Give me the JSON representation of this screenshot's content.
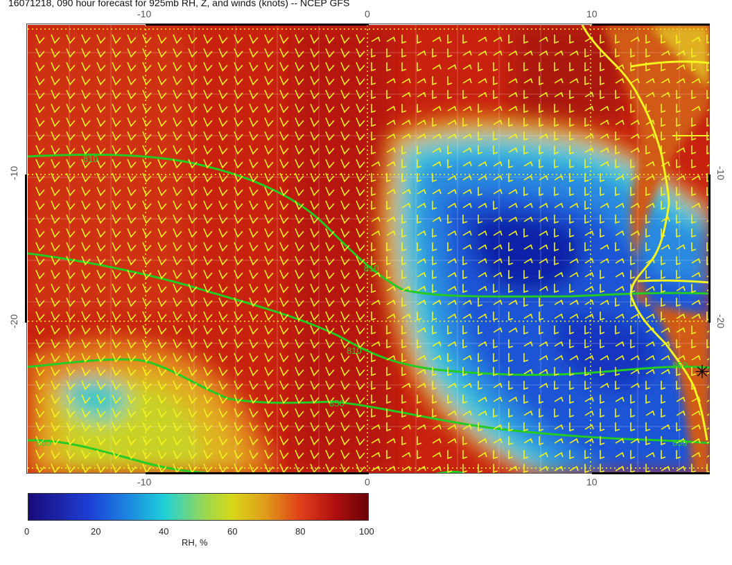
{
  "title": "16071218, 090 hour forecast for 925mb RH, Z, and winds (knots) -- NCEP GFS",
  "axes": {
    "top": [
      "-10",
      "0",
      "10"
    ],
    "bottom": [
      "-10",
      "0",
      "10"
    ],
    "left": [
      "-10",
      "-20"
    ],
    "right": [
      "-10",
      "-20"
    ]
  },
  "contours": {
    "c1": "810",
    "c2": "810",
    "c3": "810",
    "c4": "850",
    "c5": "850",
    "c6": "850",
    "c7": "850"
  },
  "colorbar": {
    "ticks": [
      "0",
      "20",
      "40",
      "60",
      "80",
      "100"
    ],
    "label": "RH, %"
  },
  "colors": {
    "rh_0": "#1a0a78",
    "rh_20": "#1c3fd6",
    "rh_40": "#1fd0d8",
    "rh_60": "#d8d81a",
    "rh_80": "#e0401a",
    "rh_100": "#6a0208",
    "contour": "#22cc22",
    "coastline": "#f5f520",
    "barbs": "#f5f520"
  }
}
